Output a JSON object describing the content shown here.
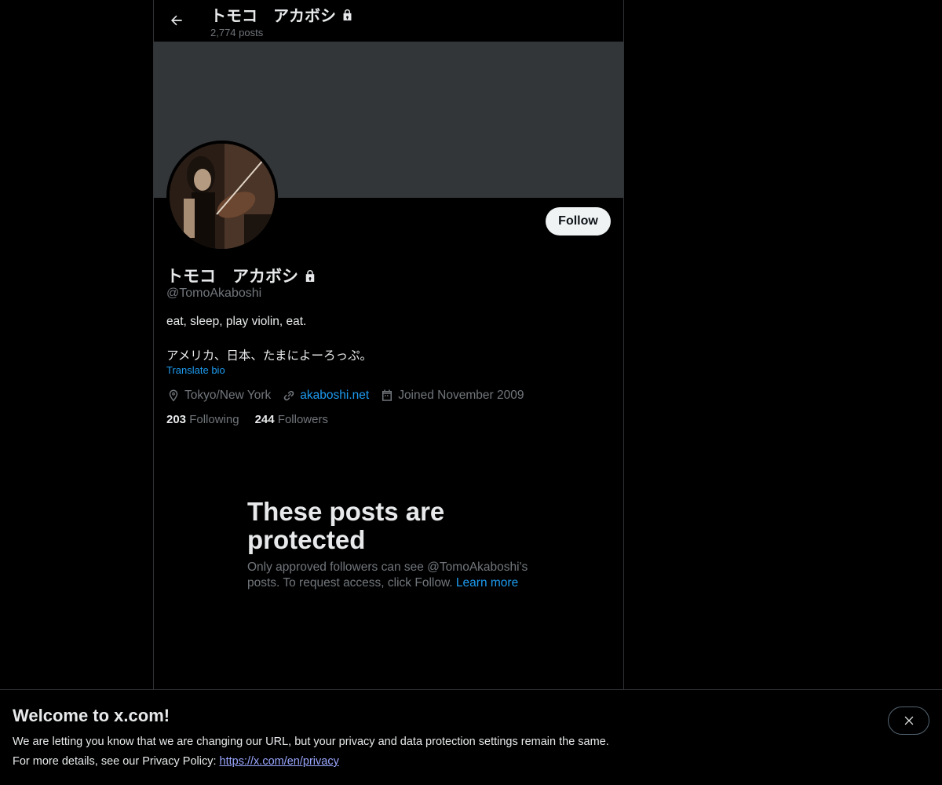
{
  "header": {
    "title": "トモコ　アカボシ",
    "posts_count": "2,774 posts"
  },
  "profile": {
    "display_name": "トモコ　アカボシ",
    "handle": "@TomoAkaboshi",
    "follow_label": "Follow",
    "bio_lines": [
      "eat, sleep, play violin, eat.",
      " アメリカ、日本、たまによーろっぷ。"
    ],
    "translate_label": "Translate bio",
    "location": "Tokyo/New York",
    "website": "akaboshi.net",
    "joined": "Joined November 2009",
    "following_count": "203",
    "following_label": "Following",
    "followers_count": "244",
    "followers_label": "Followers"
  },
  "protected": {
    "title": "These posts are protected",
    "text": "Only approved followers can see @TomoAkaboshi's posts. To request access, click Follow.",
    "learn_more": "Learn more"
  },
  "notice": {
    "title": "Welcome to x.com!",
    "line1": "We are letting you know that we are changing our URL, but your privacy and data protection settings remain the same.",
    "line2_prefix": "For more details, see our Privacy Policy: ",
    "line2_link": "https://x.com/en/privacy"
  },
  "colors": {
    "background": "#000000",
    "banner": "#333639",
    "accent": "#1d9bf0",
    "muted": "#71767b"
  },
  "icons": [
    "arrow-left-icon",
    "lock-icon",
    "location-icon",
    "link-icon",
    "calendar-icon",
    "close-icon"
  ]
}
